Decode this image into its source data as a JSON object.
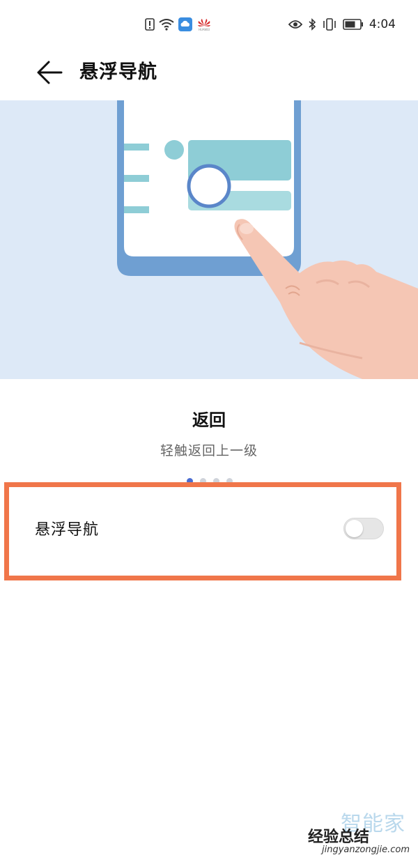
{
  "status_bar": {
    "time": "4:04",
    "left_icons": [
      "alert-icon",
      "wifi-icon",
      "cloud-icon",
      "huawei-logo"
    ],
    "right_icons": [
      "eye-icon",
      "bluetooth-icon",
      "vibrate-icon",
      "battery-icon"
    ],
    "brand_text": "HUAWEI"
  },
  "header": {
    "title": "悬浮导航",
    "back_icon": "arrow-left-icon"
  },
  "illustration": {
    "description_icon": "floating-nav-illustration",
    "bg_color": "#dde9f7"
  },
  "caption": {
    "title": "返回",
    "subtitle": "轻触返回上一级"
  },
  "pager": {
    "count": 4,
    "active_index": 0
  },
  "setting": {
    "label": "悬浮导航",
    "enabled": false
  },
  "colors": {
    "highlight": "#f0764a",
    "accent": "#4a6cd1"
  },
  "watermark": {
    "top": "智能家",
    "mid": "经验总结",
    "url": "jingyanzongjie.com"
  }
}
